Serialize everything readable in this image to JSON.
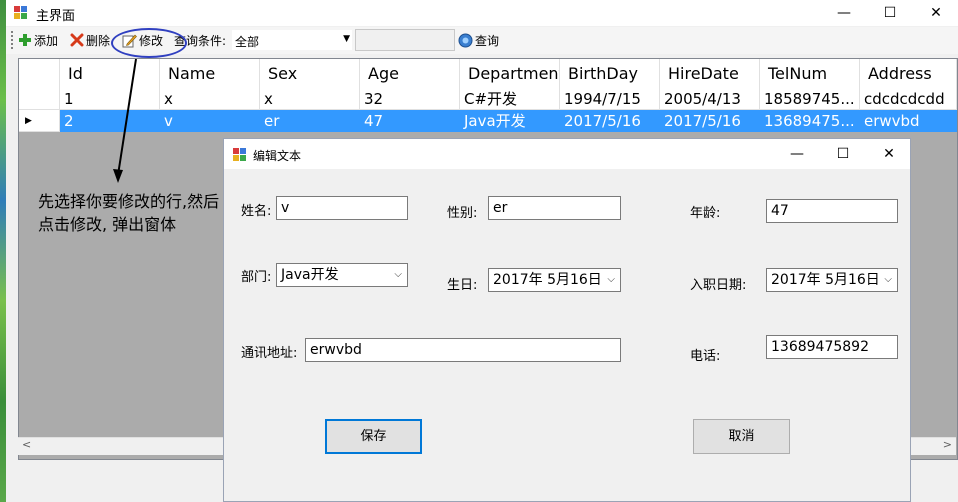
{
  "main_window": {
    "title": "主界面",
    "controls": {
      "minimize": "—",
      "maximize": "☐",
      "close": "✕"
    }
  },
  "toolbar": {
    "add_label": "添加",
    "delete_label": "删除",
    "edit_label": "修改",
    "filter_label": "查询条件:",
    "filter_value": "全部",
    "search_value": "",
    "query_label": "查询"
  },
  "grid": {
    "columns": [
      "Id",
      "Name",
      "Sex",
      "Age",
      "Department",
      "BirthDay",
      "HireDate",
      "TelNum",
      "Address"
    ],
    "rows": [
      {
        "selected": false,
        "cells": [
          "1",
          "x",
          "x",
          "32",
          "C#开发",
          "1994/7/15",
          "2005/4/13",
          "18589745...",
          "cdcdcdcdd"
        ]
      },
      {
        "selected": true,
        "cells": [
          "2",
          "v",
          "er",
          "47",
          "Java开发",
          "2017/5/16",
          "2017/5/16",
          "13689475...",
          "erwvbd"
        ]
      }
    ]
  },
  "annotation": {
    "text": "先选择你要修改的行,然后点击修改, 弹出窗体"
  },
  "dialog": {
    "title": "编辑文本",
    "controls": {
      "minimize": "—",
      "maximize": "☐",
      "close": "✕"
    },
    "name_label": "姓名:",
    "name_value": "v",
    "sex_label": "性别:",
    "sex_value": "er",
    "age_label": "年龄:",
    "age_value": "47",
    "dept_label": "部门:",
    "dept_value": "Java开发",
    "birth_label": "生日:",
    "birth_value": "2017年  5月16日",
    "hire_label": "入职日期:",
    "hire_value": "2017年  5月16日",
    "address_label": "通讯地址:",
    "address_value": "erwvbd",
    "tel_label": "电话:",
    "tel_value": "13689475892",
    "save_label": "保存",
    "cancel_label": "取消"
  },
  "colors": {
    "selection": "#3399ff",
    "annotation_ellipse": "#3040c0",
    "save_border": "#0078d7"
  }
}
